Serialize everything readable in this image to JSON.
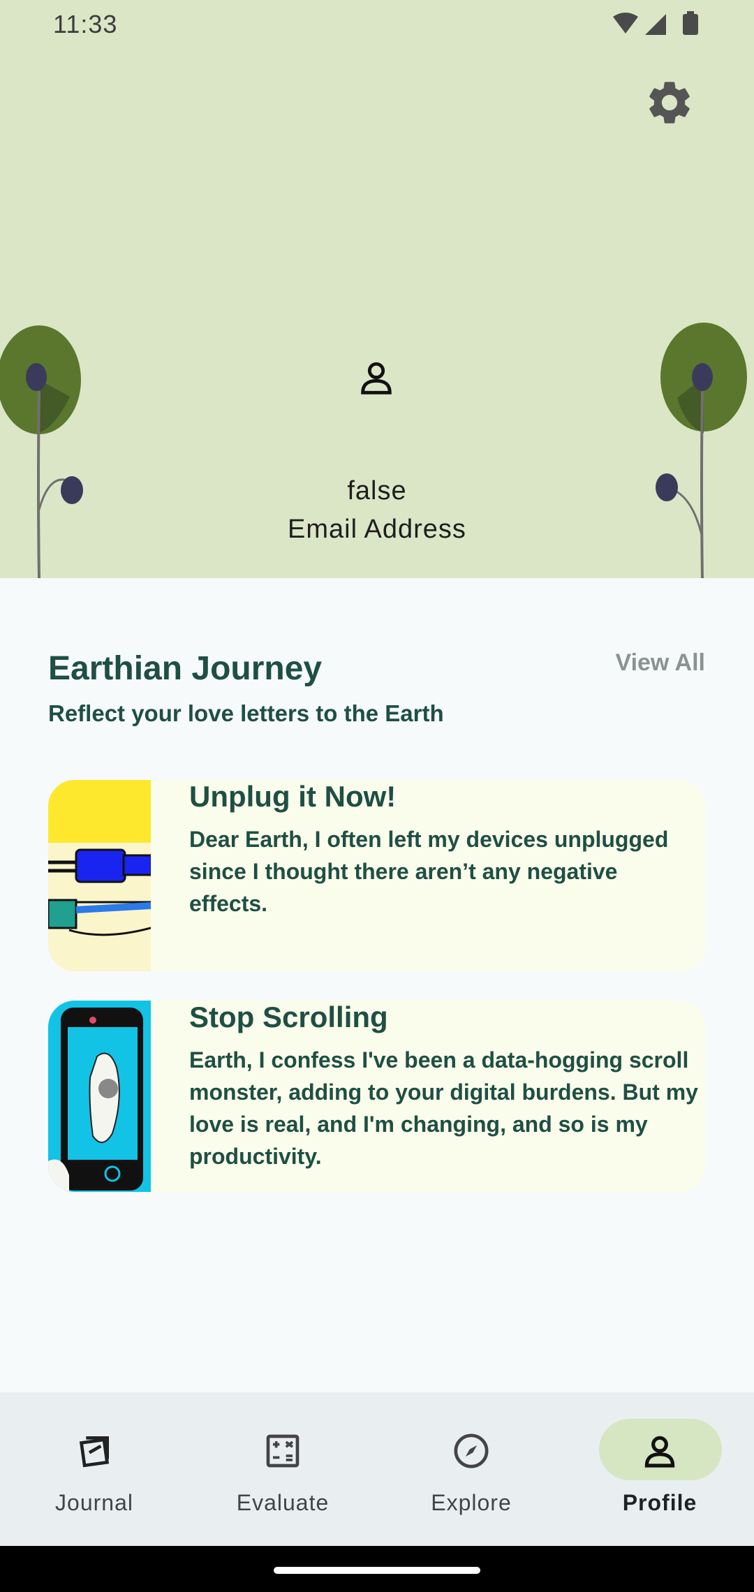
{
  "status_bar": {
    "time": "11:33"
  },
  "profile": {
    "name": "false",
    "email": "Email Address"
  },
  "journey": {
    "title": "Earthian Journey",
    "subtitle": "Reflect your love letters to the Earth",
    "view_all": "View All",
    "cards": [
      {
        "title": "Unplug it Now!",
        "body": "Dear Earth, I often left my devices unplugged since I thought there aren’t any negative effects."
      },
      {
        "title": "Stop Scrolling",
        "body": "Earth, I confess I've been a data-hogging scroll monster, adding to your digital burdens. But my love is real, and I'm changing, and so is my productivity."
      }
    ]
  },
  "nav": {
    "items": [
      {
        "label": "Journal",
        "icon": "journal-icon"
      },
      {
        "label": "Evaluate",
        "icon": "calculator-icon"
      },
      {
        "label": "Explore",
        "icon": "compass-icon"
      },
      {
        "label": "Profile",
        "icon": "person-icon"
      }
    ],
    "active": "Profile"
  },
  "colors": {
    "header_bg": "#dbe6c6",
    "accent_text": "#1f4f44",
    "card_bg": "#fafdeb",
    "nav_active_pill": "#d6e5c2"
  }
}
